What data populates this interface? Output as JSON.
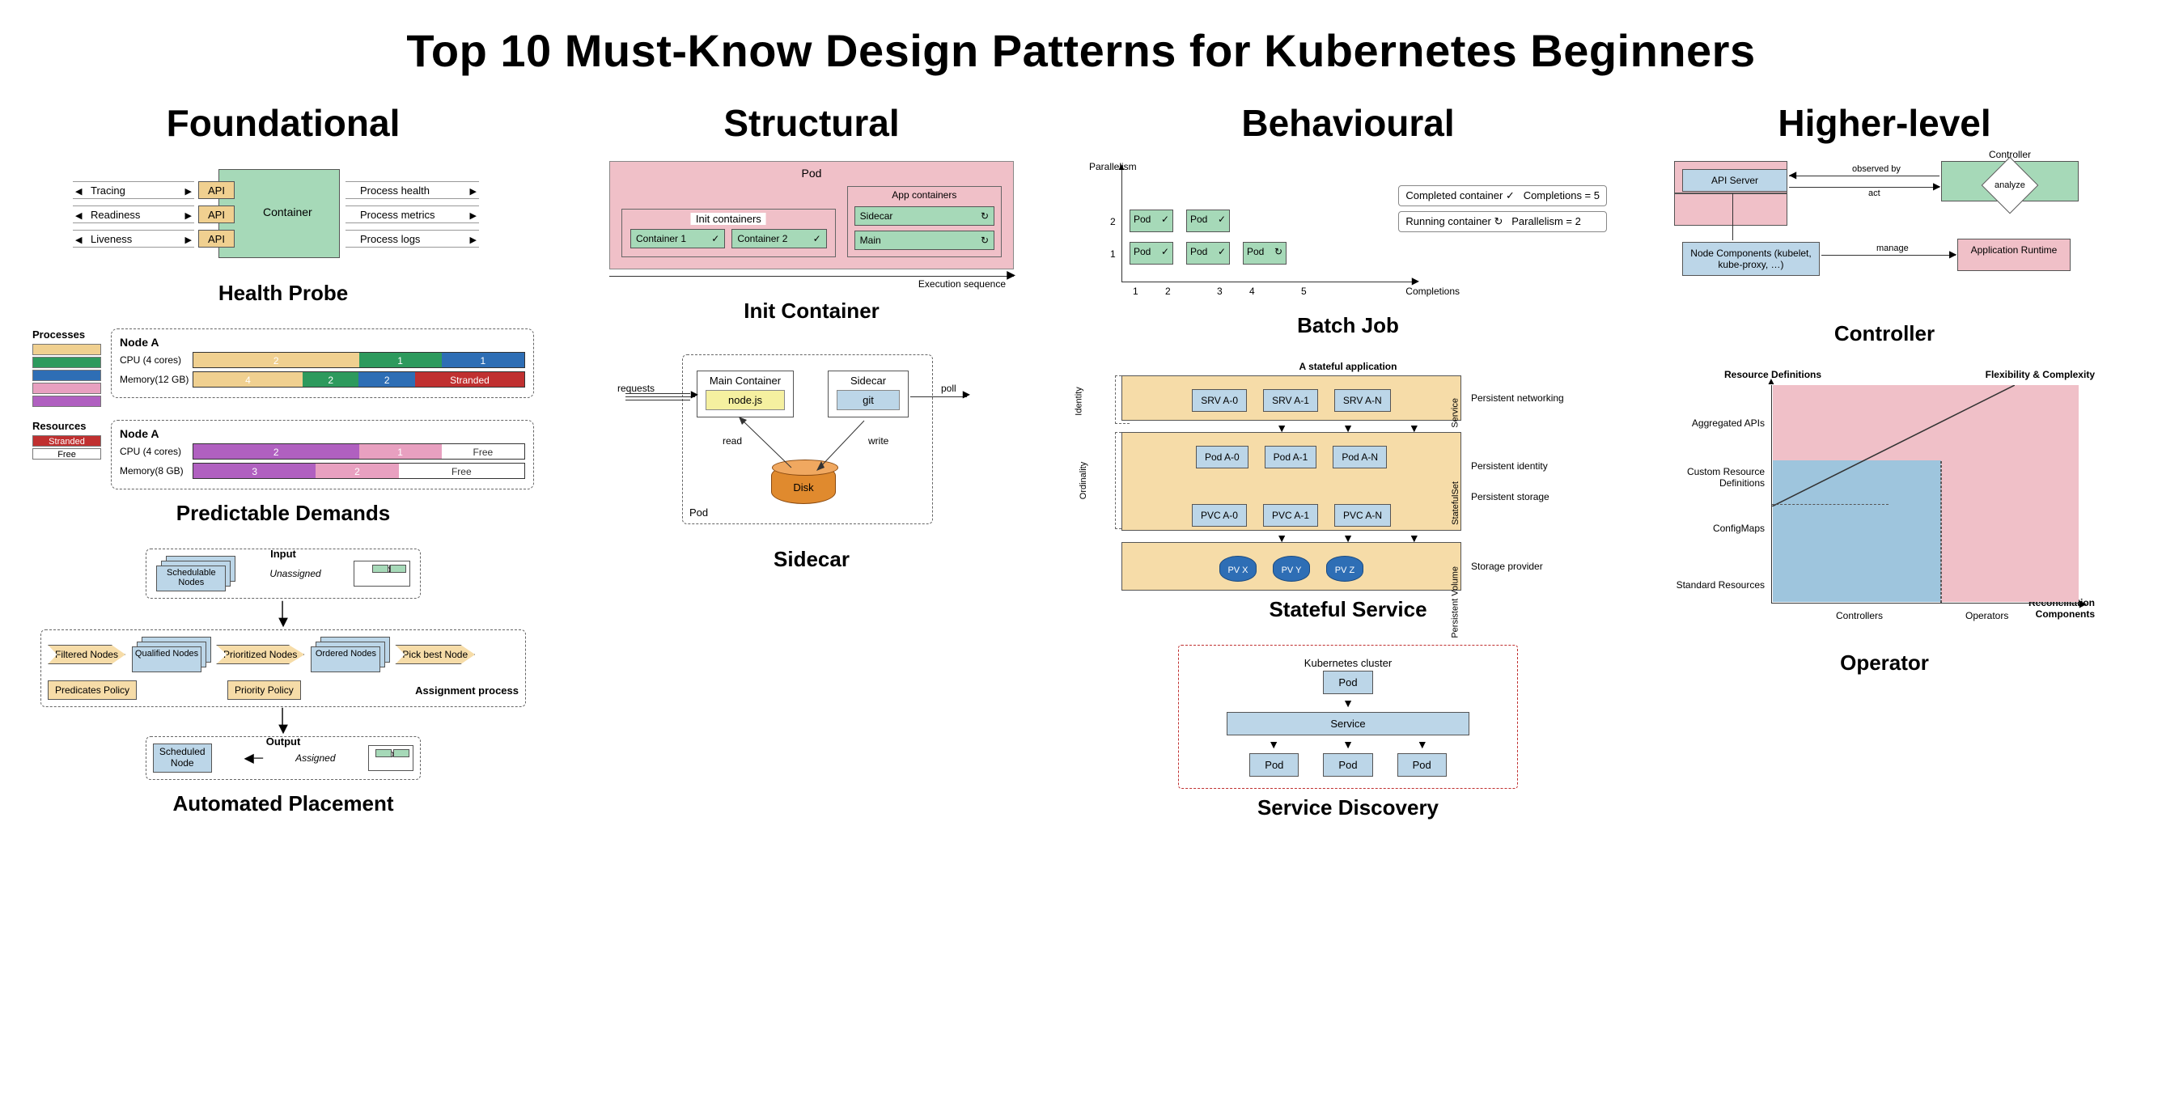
{
  "title": "Top 10 Must-Know Design Patterns for Kubernetes Beginners",
  "columns": {
    "foundational": "Foundational",
    "structural": "Structural",
    "behavioural": "Behavioural",
    "higher": "Higher-level"
  },
  "patterns": {
    "health_probe": "Health Probe",
    "predictable": "Predictable Demands",
    "auto_place": "Automated Placement",
    "init": "Init Container",
    "sidecar": "Sidecar",
    "batch": "Batch Job",
    "stateful": "Stateful Service",
    "discovery": "Service Discovery",
    "controller": "Controller",
    "operator": "Operator"
  },
  "hp": {
    "container": "Container",
    "api": "API",
    "left": [
      "Tracing",
      "Readiness",
      "Liveness"
    ],
    "right": [
      "Process health",
      "Process metrics",
      "Process logs"
    ]
  },
  "pd": {
    "processes": "Processes",
    "resources": "Resources",
    "nodeA": "Node A",
    "cpu4": "CPU (4 cores)",
    "mem12": "Memory(12 GB)",
    "mem8": "Memory(8 GB)",
    "stranded": "Stranded",
    "free": "Free",
    "bar1_cpu": [
      {
        "w": 50,
        "c": "sw-tan",
        "t": "2"
      },
      {
        "w": 25,
        "c": "sw-grn",
        "t": "1"
      },
      {
        "w": 25,
        "c": "sw-blu",
        "t": "1"
      }
    ],
    "bar1_mem": [
      {
        "w": 33,
        "c": "sw-tan",
        "t": "4"
      },
      {
        "w": 17,
        "c": "sw-grn",
        "t": "2"
      },
      {
        "w": 17,
        "c": "sw-blu",
        "t": "2"
      },
      {
        "w": 33,
        "c": "sw-red",
        "t": "Stranded"
      }
    ],
    "bar2_cpu": [
      {
        "w": 50,
        "c": "sw-pur",
        "t": "2"
      },
      {
        "w": 25,
        "c": "sw-pnk",
        "t": "1"
      },
      {
        "w": 25,
        "c": "sw-free",
        "t": "Free",
        "fg": "#333"
      }
    ],
    "bar2_mem": [
      {
        "w": 37,
        "c": "sw-pur",
        "t": "3"
      },
      {
        "w": 25,
        "c": "sw-pnk",
        "t": "2"
      },
      {
        "w": 38,
        "c": "sw-free",
        "t": "Free",
        "fg": "#333"
      }
    ]
  },
  "ap": {
    "input": "Input",
    "schedulable": "Schedulable Nodes",
    "unassigned": "Unassigned",
    "pod": "Pod",
    "filtered": "Filtered Nodes",
    "qualified": "Qualified Nodes",
    "prioritized": "Prioritized Nodes",
    "ordered": "Ordered Nodes",
    "pick": "Pick best Node",
    "predicates": "Predicates Policy",
    "priority": "Priority Policy",
    "assign_proc": "Assignment process",
    "output": "Output",
    "scheduled": "Scheduled Node",
    "assigned": "Assigned"
  },
  "ic": {
    "pod": "Pod",
    "init_label": "Init containers",
    "c1": "Container 1",
    "c2": "Container 2",
    "app_label": "App containers",
    "sidecar": "Sidecar",
    "main": "Main",
    "axis": "Execution sequence",
    "check": "✓",
    "spin": "↻"
  },
  "sc": {
    "requests": "requests",
    "main": "Main Container",
    "nodejs": "node.js",
    "sidecar": "Sidecar",
    "git": "git",
    "poll": "poll",
    "read": "read",
    "write": "write",
    "disk": "Disk",
    "pod": "Pod"
  },
  "bj": {
    "ylabel": "Parallelism",
    "xlabel": "Completions",
    "pod": "Pod",
    "check": "✓",
    "spin": "↻",
    "legend1": "Completed container",
    "legend2": "Running container",
    "legend1r": "Completions = 5",
    "legend2r": "Parallelism = 2",
    "yticks": [
      "1",
      "2"
    ],
    "xticks": [
      "1",
      "2",
      "3",
      "4",
      "5"
    ]
  },
  "ss": {
    "title": "A stateful application",
    "identity": "Identity",
    "ordinality": "Ordinality",
    "service": "Service",
    "statefulset": "StatefulSet",
    "pvolume": "Persistent Volume",
    "srv": [
      "SRV A-0",
      "SRV A-1",
      "SRV A-N"
    ],
    "pods": [
      "Pod A-0",
      "Pod A-1",
      "Pod A-N"
    ],
    "pvc": [
      "PVC A-0",
      "PVC A-1",
      "PVC A-N"
    ],
    "pv": [
      "PV X",
      "PV Y",
      "PV Z"
    ],
    "desc": [
      "Persistent networking",
      "Persistent identity",
      "Persistent storage",
      "Storage provider"
    ]
  },
  "sd": {
    "cluster": "Kubernetes cluster",
    "pod": "Pod",
    "service": "Service"
  },
  "ct": {
    "api": "API Server",
    "observed": "observed by",
    "act": "act",
    "controller": "Controller",
    "analyze": "analyze",
    "node": "Node Components (kubelet, kube-proxy, …)",
    "manage": "manage",
    "app": "Application Runtime"
  },
  "op": {
    "ytop": "Resource Definitions",
    "xcorner": "Flexibility & Complexity",
    "xr": "Reconciliation Components",
    "ylabels": [
      "Aggregated APIs",
      "Custom Resource Definitions",
      "ConfigMaps",
      "Standard Resources"
    ],
    "xlabels": [
      "Controllers",
      "Operators"
    ]
  }
}
